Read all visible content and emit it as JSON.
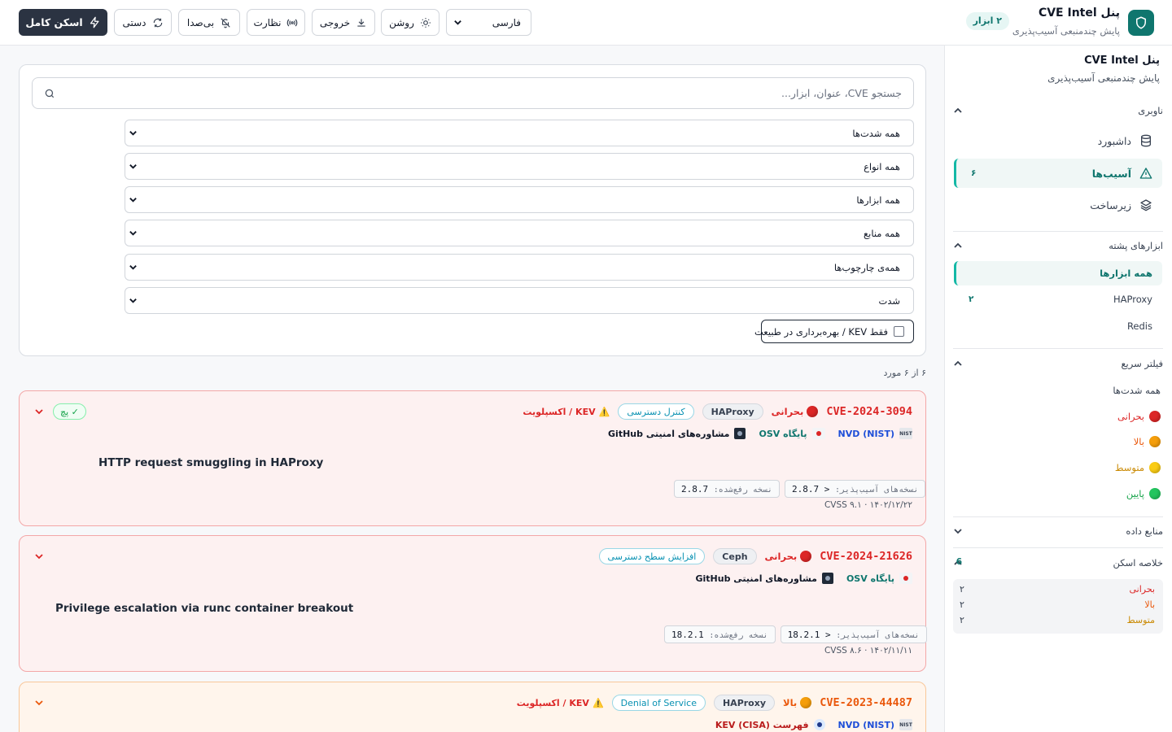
{
  "header": {
    "brand_title": "پنل CVE Intel",
    "brand_subtitle": "پایش چندمنبعی آسیب‌پذیری",
    "tools_badge": "۲ ابزار",
    "language": "فارسی",
    "buttons": {
      "theme": "روشن",
      "export": "خروجی",
      "monitor": "نظارت",
      "mute": "بی‌صدا",
      "manual": "دستی",
      "full_scan": "اسکن کامل"
    }
  },
  "sidebar": {
    "title": "پنل CVE Intel",
    "subtitle": "پایش چندمنبعی آسیب‌پذیری",
    "nav_title": "ناوبری",
    "nav_items": [
      {
        "label": "داشبورد",
        "icon": "database-icon"
      },
      {
        "label": "آسیب‌ها",
        "icon": "warning-triangle-icon",
        "count": "۶"
      },
      {
        "label": "زیرساخت",
        "icon": "layers-icon"
      }
    ],
    "stack_title": "ابزارهای پشته",
    "tools": [
      {
        "label": "همه ابزارها"
      },
      {
        "label": "HAProxy",
        "count": "۲"
      },
      {
        "label": "Redis"
      }
    ],
    "quick_filter_title": "فیلتر سریع",
    "quick_filters": [
      {
        "label": "همه شدت‌ها",
        "color": ""
      },
      {
        "label": "بحرانی",
        "color": "#dc2626"
      },
      {
        "label": "بالا",
        "color": "#f59e0b"
      },
      {
        "label": "متوسط",
        "color": "#facc15"
      },
      {
        "label": "پایین",
        "color": "#22c55e"
      }
    ],
    "sources_title": "منابع داده",
    "summary_title": "خلاصه اسکن",
    "summary_total": "6",
    "summary_rows": [
      {
        "label": "بحرانی",
        "value": "۲",
        "color": "#dc2626"
      },
      {
        "label": "بالا",
        "value": "۲",
        "color": "#ea580c"
      },
      {
        "label": "متوسط",
        "value": "۲",
        "color": "#ca8a04"
      }
    ]
  },
  "filters": {
    "search_placeholder": "جستجو CVE، عنوان، ابزار...",
    "selects": [
      "همه شدت‌ها",
      "همه انواع",
      "همه ابزارها",
      "همه منابع",
      "همه‌ی چارچوب‌ها",
      "شدت"
    ],
    "kev_only_label": "فقط KEV / بهره‌برداری در طبیعت",
    "kev_only_checked": false
  },
  "results_count": "۶ از ۶ مورد",
  "cves": [
    {
      "id": "CVE-2024-3094",
      "severity": "بحرانی",
      "severity_color": "#dc2626",
      "tool": "HAProxy",
      "category": "کنترل دسترسی",
      "kev_label": "KEV / اکسپلویت",
      "patched_label": "✓ پچ",
      "sources": [
        {
          "label": "NVD (NIST)",
          "icon": "nist-logo-icon",
          "color": "#1d4ed8"
        },
        {
          "label": "پایگاه OSV",
          "icon": "osv-logo-icon",
          "color": "#0f766e"
        },
        {
          "label": "مشاوره‌های امنیتی GitHub",
          "icon": "github-logo-icon",
          "color": "#111827"
        }
      ],
      "title": "HTTP request smuggling in HAProxy",
      "affected": "< 2.8.7",
      "affected_label": "نسخه‌های آسیب‌پذیر:",
      "fixed": "2.8.7",
      "fixed_label": "نسخه رفع‌شده:",
      "date": "۱۴۰۲/۱۲/۲۲",
      "cvss": "CVSS ۹.۱"
    },
    {
      "id": "CVE-2024-21626",
      "severity": "بحرانی",
      "severity_color": "#dc2626",
      "tool": "Ceph",
      "category": "افزایش سطح دسترسی",
      "sources": [
        {
          "label": "پایگاه OSV",
          "icon": "osv-logo-icon",
          "color": "#0f766e"
        },
        {
          "label": "مشاوره‌های امنیتی GitHub",
          "icon": "github-logo-icon",
          "color": "#111827"
        }
      ],
      "title": "Privilege escalation via runc container breakout",
      "affected": "< 18.2.1",
      "affected_label": "نسخه‌های آسیب‌پذیر:",
      "fixed": "18.2.1",
      "fixed_label": "نسخه رفع‌شده:",
      "date": "۱۴۰۲/۱۱/۱۱",
      "cvss": "CVSS ۸.۶"
    },
    {
      "id": "CVE-2023-44487",
      "severity": "بالا",
      "severity_color": "#f59e0b",
      "tool": "HAProxy",
      "category": "Denial of Service",
      "kev_label": "KEV / اکسپلویت",
      "sources": [
        {
          "label": "NVD (NIST)",
          "icon": "nist-logo-icon",
          "color": "#1d4ed8"
        },
        {
          "label": "فهرست KEV (CISA)",
          "icon": "cisa-seal-icon",
          "color": "#b91c1c"
        }
      ]
    }
  ],
  "colors": {
    "accent": "#0f766e",
    "critical": "#dc2626",
    "high": "#ea580c",
    "primary_button": "#2b3342"
  }
}
